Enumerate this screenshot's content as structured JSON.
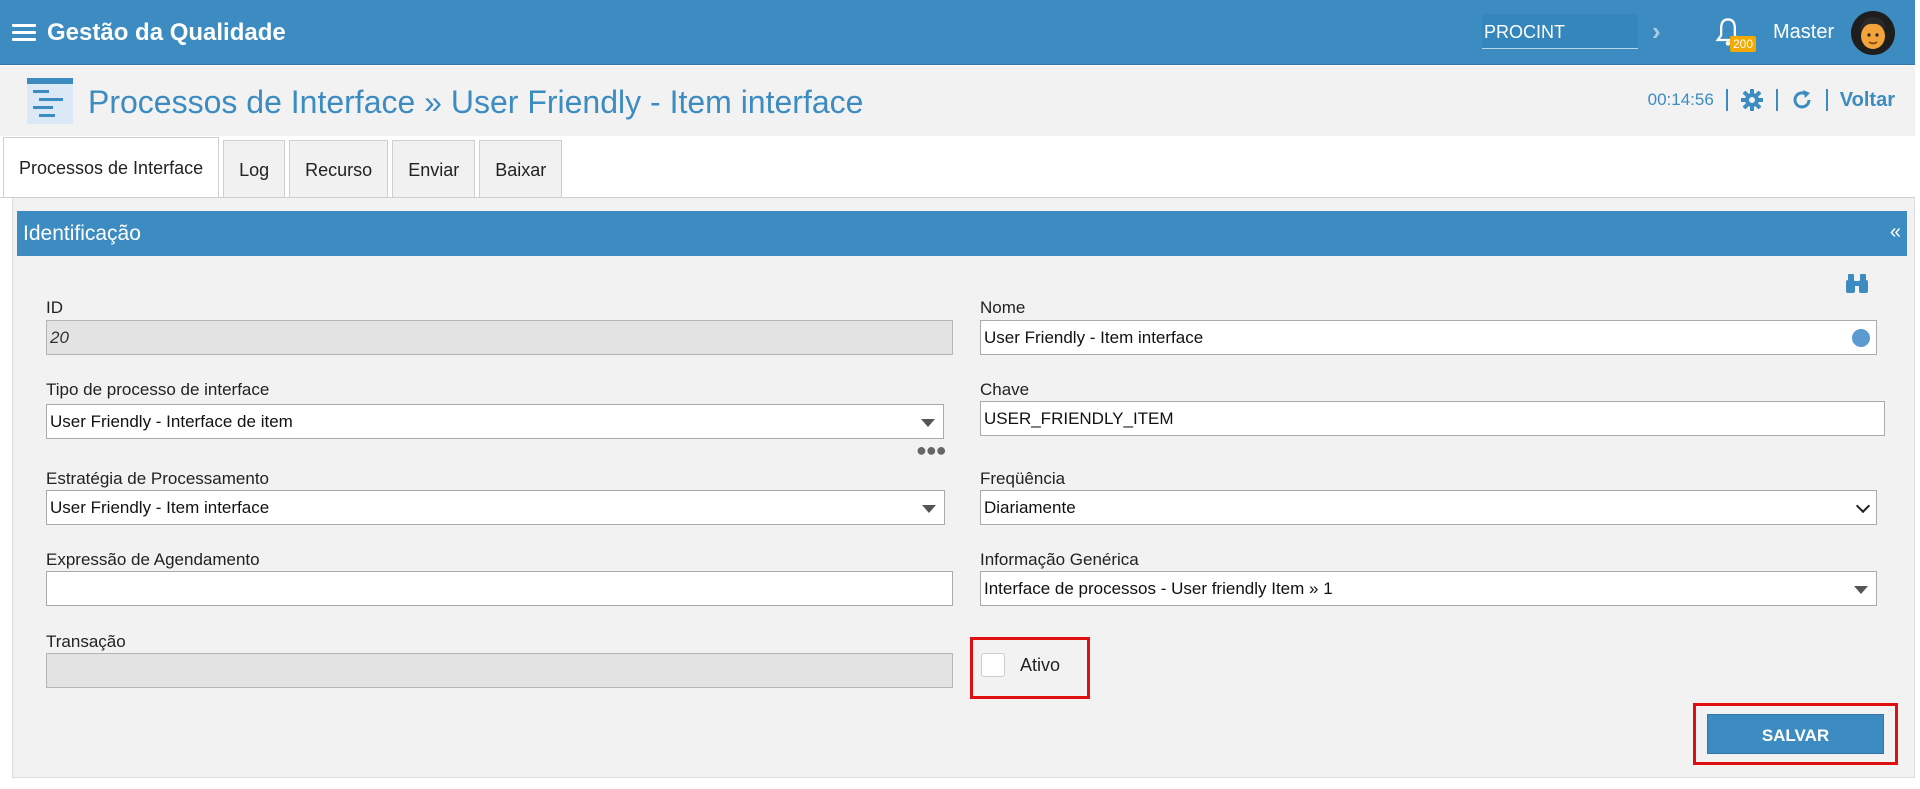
{
  "header": {
    "app_title": "Gestão da Qualidade",
    "context_value": "PROCINT",
    "notification_count": "200",
    "user_name": "Master"
  },
  "page": {
    "title": "Processos de Interface » User Friendly - Item interface",
    "timer": "00:14:56",
    "back_label": "Voltar"
  },
  "tabs": [
    {
      "label": "Processos de Interface",
      "active": true
    },
    {
      "label": "Log"
    },
    {
      "label": "Recurso"
    },
    {
      "label": "Enviar"
    },
    {
      "label": "Baixar"
    }
  ],
  "section": {
    "title": "Identificação",
    "collapse_glyph": "«"
  },
  "form": {
    "id": {
      "label": "ID",
      "value": "20"
    },
    "nome": {
      "label": "Nome",
      "value": "User Friendly - Item interface"
    },
    "tipo": {
      "label": "Tipo de processo de interface",
      "value": "User Friendly - Interface de item"
    },
    "chave": {
      "label": "Chave",
      "value": "USER_FRIENDLY_ITEM"
    },
    "estrategia": {
      "label": "Estratégia de Processamento",
      "value": "User Friendly - Item interface"
    },
    "frequencia": {
      "label": "Freqüência",
      "value": "Diariamente"
    },
    "expressao": {
      "label": "Expressão de Agendamento",
      "value": ""
    },
    "informacao": {
      "label": "Informação Genérica",
      "value": "Interface de processos - User friendly Item » 1"
    },
    "transacao": {
      "label": "Transação",
      "value": ""
    },
    "ativo": {
      "label": "Ativo",
      "checked": false
    }
  },
  "actions": {
    "save_label": "SALVAR"
  },
  "icons": {
    "menu": "hamburger-icon",
    "bell": "bell-icon",
    "settings": "gear-icon",
    "refresh": "refresh-icon",
    "search": "binoculars-icon",
    "globe": "globe-icon"
  },
  "colors": {
    "primary": "#3d8cc1",
    "badge": "#f2a900",
    "highlight": "#e01010"
  }
}
